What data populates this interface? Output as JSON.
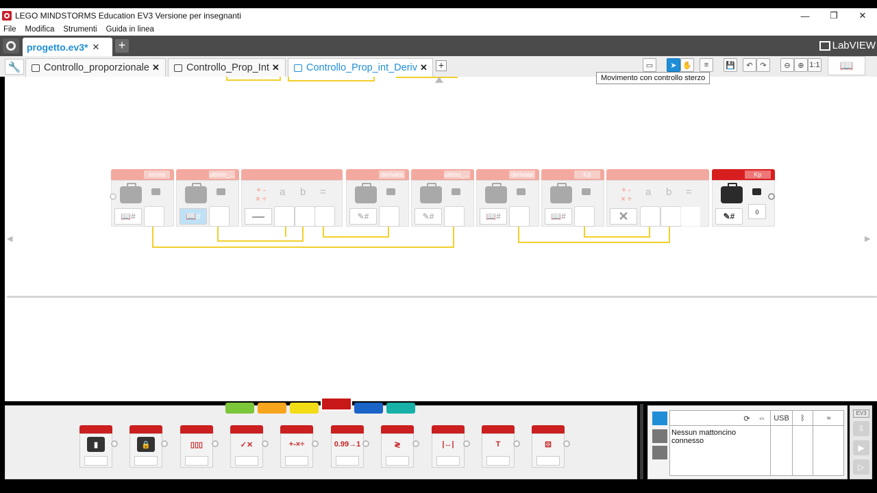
{
  "window": {
    "title": "LEGO MINDSTORMS Education EV3 Versione per insegnanti",
    "controls": [
      "—",
      "❐",
      "✕"
    ]
  },
  "menu": [
    "File",
    "Modifica",
    "Strumenti",
    "Guida in linea"
  ],
  "project": {
    "tab_label": "progetto.ev3*",
    "close": "✕",
    "add": "+",
    "brand": "LabVIEW"
  },
  "program_tabs": [
    {
      "label": "Controllo_proporzionale",
      "close": "✕"
    },
    {
      "label": "Controllo_Prop_Int",
      "close": "✕"
    },
    {
      "label": "Controllo_Prop_int_Deriv",
      "close": "✕"
    }
  ],
  "tab_add": "+",
  "toolbar": {
    "tooltip": "Movimento con controllo sterzo",
    "zoom_reset": "1:1"
  },
  "blocks": [
    {
      "name": "errore",
      "mode": "📖#"
    },
    {
      "name": "ultimo_...",
      "mode": "📖#"
    },
    {
      "name": "",
      "math": "+ -\n× ÷",
      "a": "a",
      "b": "b",
      "eq": "=",
      "op": "—"
    },
    {
      "name": "derivata",
      "mode": "✎#"
    },
    {
      "name": "ultimo_...",
      "mode": "✎#"
    },
    {
      "name": "derivata",
      "mode": "📖#"
    },
    {
      "name": "Kd",
      "mode": "📖#"
    },
    {
      "name": "",
      "math": "+ -\n× ÷",
      "a": "a",
      "b": "b",
      "eq": "=",
      "op": "✕"
    },
    {
      "name": "Kp",
      "mode": "✎#",
      "value": "0"
    }
  ],
  "palette": {
    "tab_colors": [
      "#7cc63a",
      "#f7a51c",
      "#f2dc16",
      "#c81818",
      "#1a64c8",
      "#17b1a8"
    ],
    "selected_tab": 3,
    "blocks": [
      {
        "icon": "variable-icon",
        "glyph": "▮"
      },
      {
        "icon": "constant-icon",
        "glyph": "🔒"
      },
      {
        "icon": "array-icon",
        "glyph": "▯▯▯"
      },
      {
        "icon": "logic-icon",
        "glyph": "✓✕"
      },
      {
        "icon": "math-icon",
        "glyph": "+-×÷"
      },
      {
        "icon": "round-icon",
        "glyph": "0.99→1"
      },
      {
        "icon": "compare-icon",
        "glyph": "≷"
      },
      {
        "icon": "range-icon",
        "glyph": "|↔|"
      },
      {
        "icon": "text-icon",
        "glyph": "T"
      },
      {
        "icon": "random-icon",
        "glyph": "⚄"
      }
    ]
  },
  "hardware": {
    "usb": "USB",
    "status": "Nessun mattoncino connesso",
    "ev3": "EV3"
  }
}
